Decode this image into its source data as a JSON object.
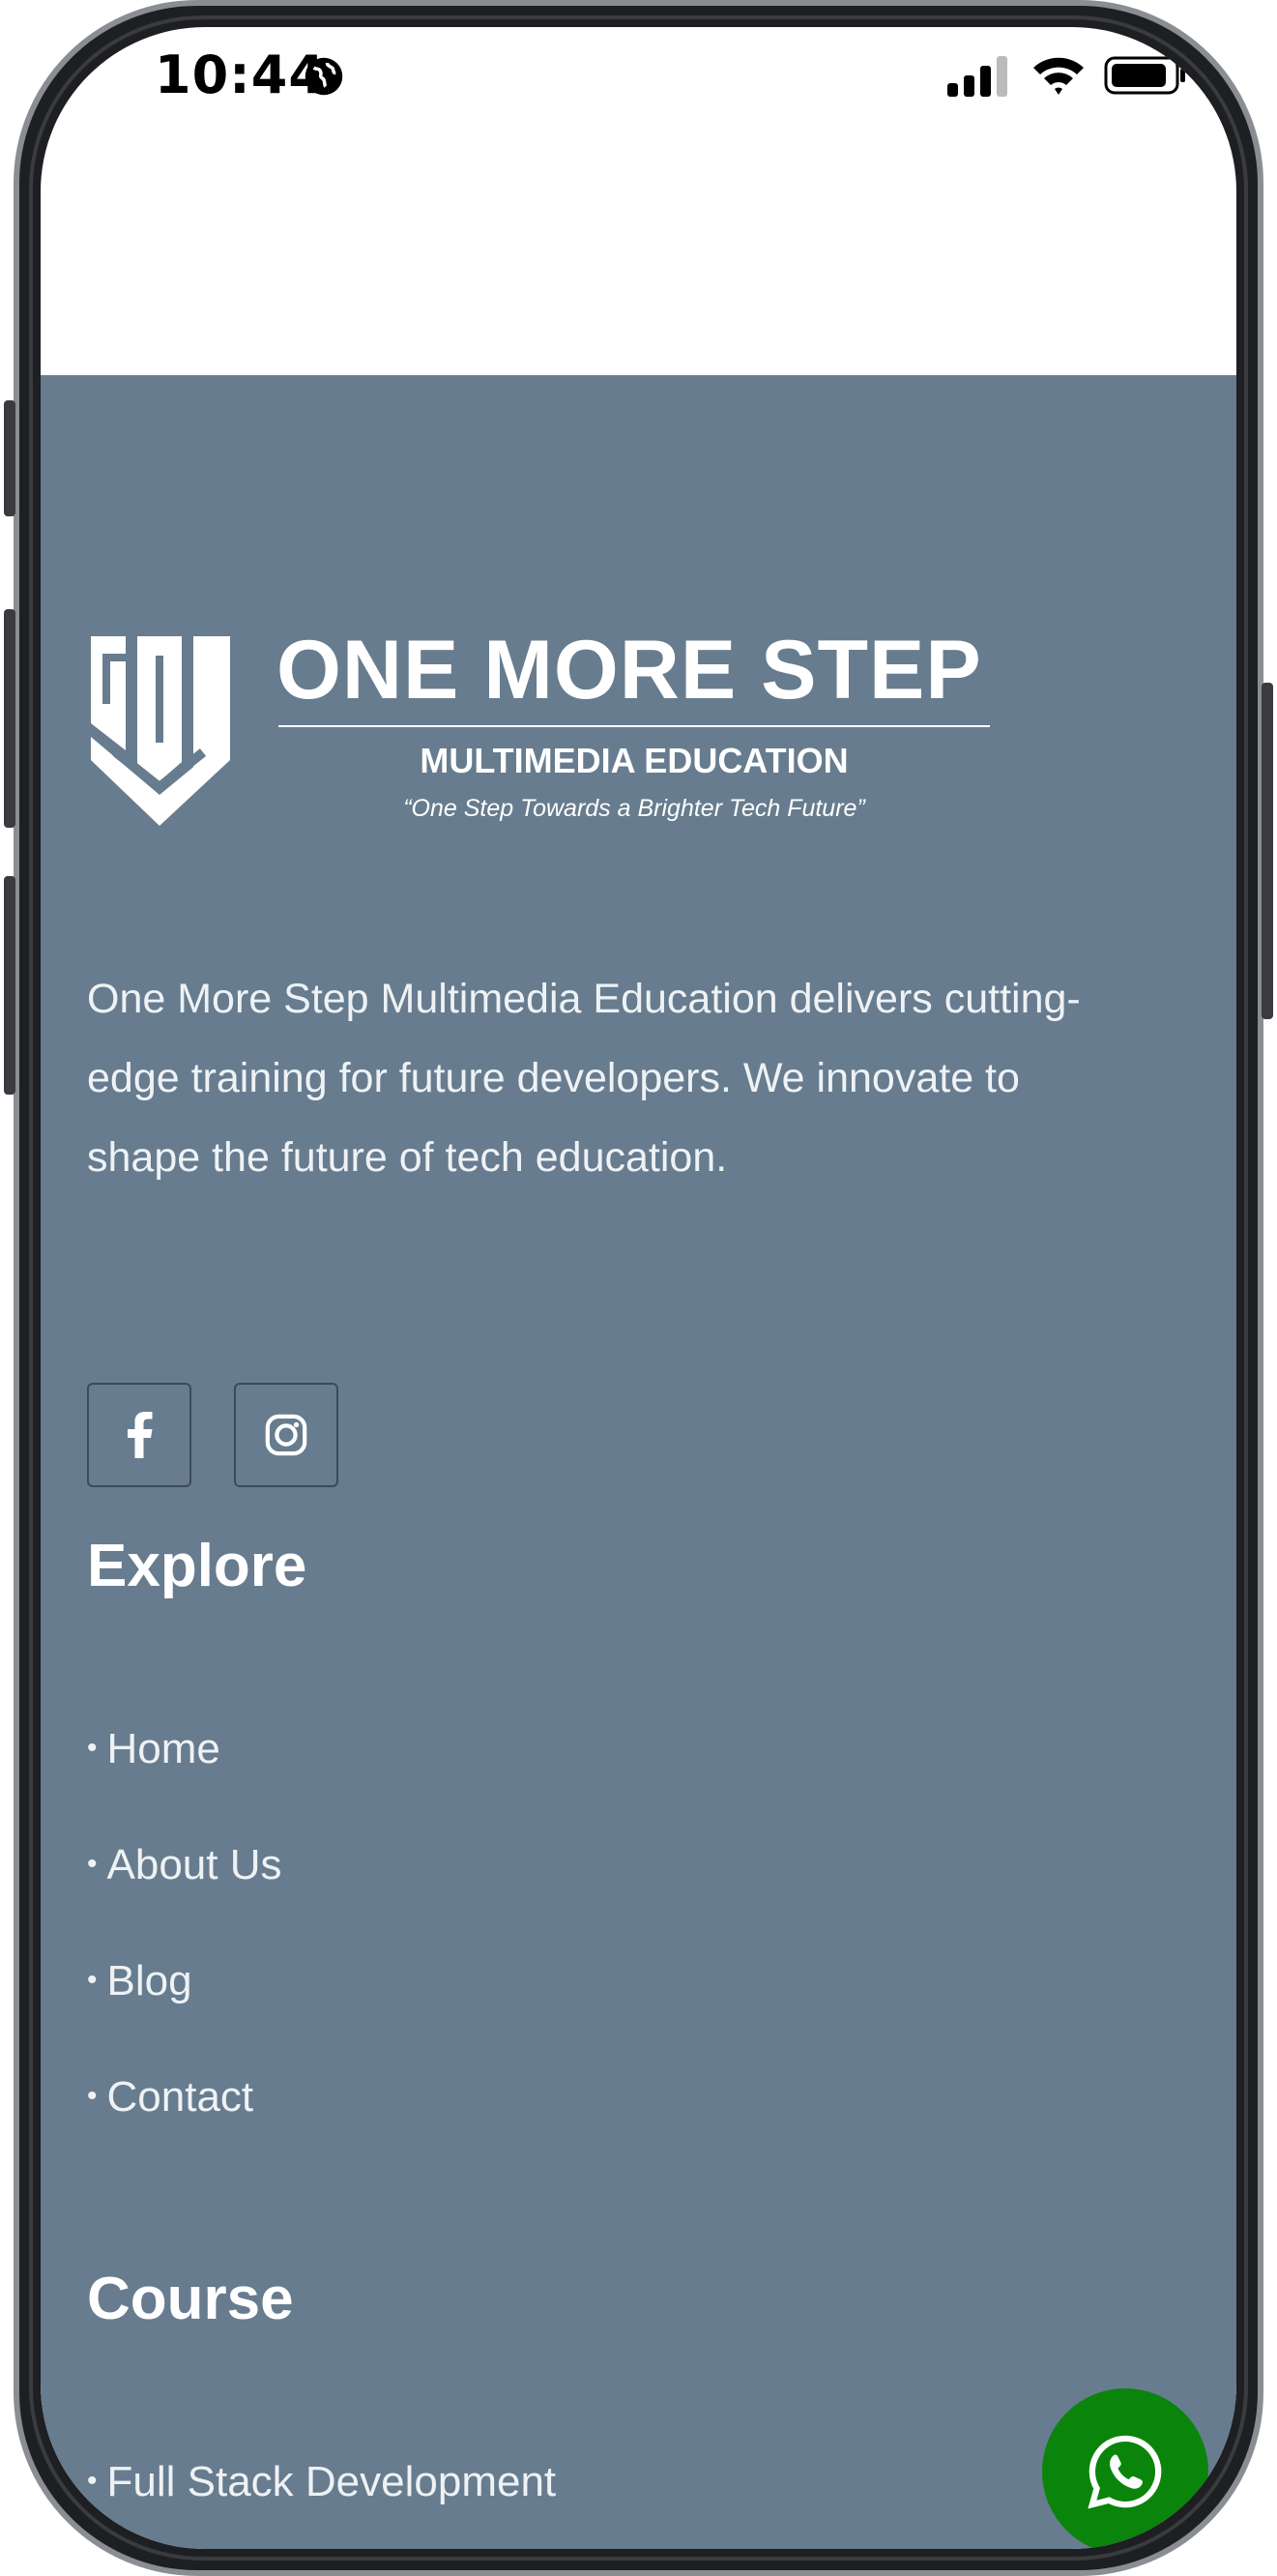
{
  "status_bar": {
    "time": "10:44"
  },
  "footer": {
    "logo": {
      "title": "ONE MORE STEP",
      "subtitle": "MULTIMEDIA EDUCATION",
      "tagline": "“One Step Towards a Brighter Tech Future”"
    },
    "description": "One More Step Multimedia Education delivers cutting-edge training for future developers. We innovate to shape the future of tech education.",
    "social": [
      "facebook-icon",
      "instagram-icon"
    ],
    "explore": {
      "heading": "Explore",
      "links": [
        "Home",
        "About Us",
        "Blog",
        "Contact"
      ]
    },
    "course": {
      "heading": "Course",
      "links": [
        "Full Stack Development"
      ]
    },
    "bullet": "•"
  },
  "colors": {
    "footer_bg": "#677c8e",
    "whatsapp_green": "#0a840a"
  }
}
